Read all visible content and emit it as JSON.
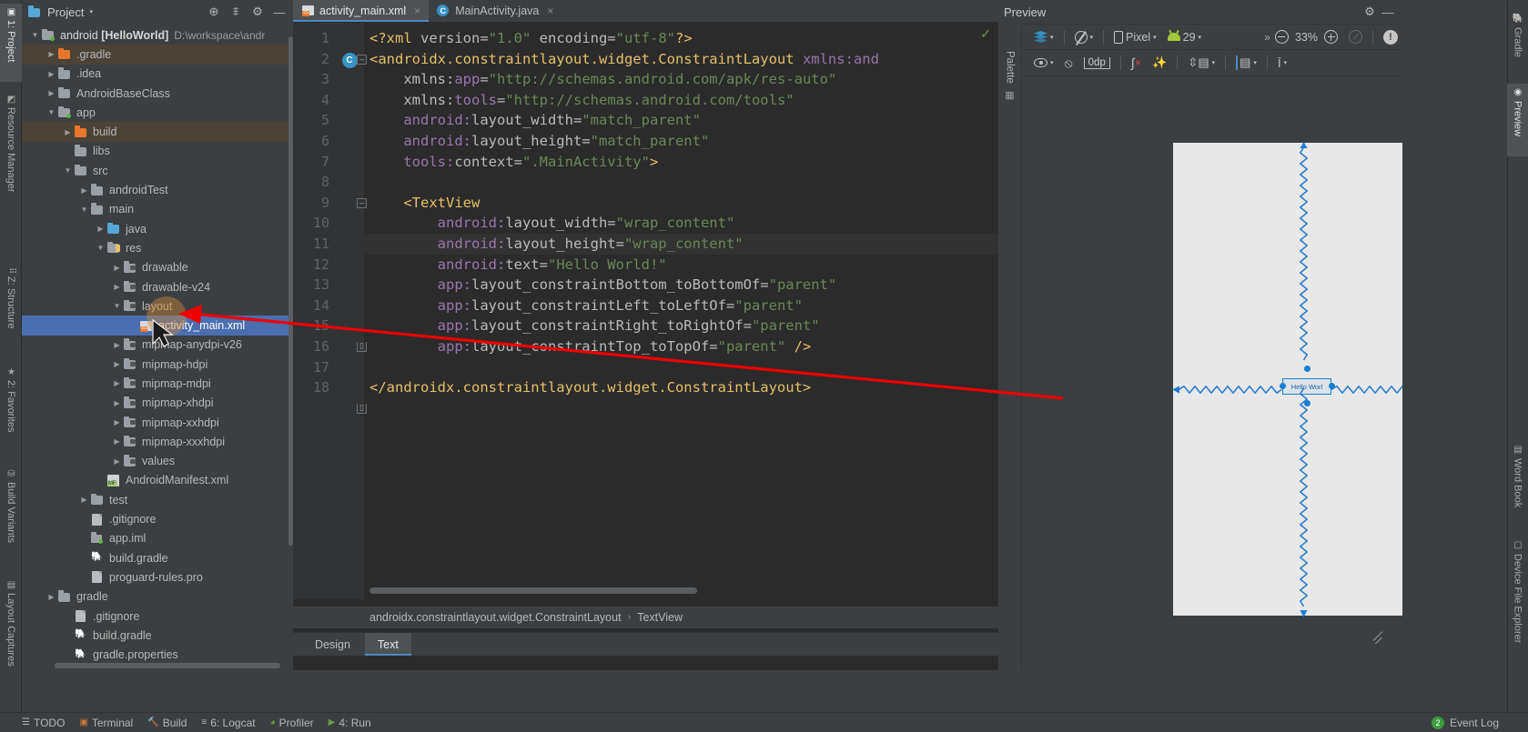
{
  "left_rail": [
    {
      "label": "1: Project",
      "icon": "project-icon",
      "selected": true
    },
    {
      "label": "Resource Manager",
      "icon": "resource-icon",
      "selected": false
    },
    {
      "label": "Z: Structure",
      "icon": "structure-icon",
      "selected": false
    },
    {
      "label": "2: Favorites",
      "icon": "star-icon",
      "selected": false
    },
    {
      "label": "Build Variants",
      "icon": "variants-icon",
      "selected": false
    },
    {
      "label": "Layout Captures",
      "icon": "captures-icon",
      "selected": false
    }
  ],
  "project_panel": {
    "title": "Project",
    "title_caret": "▾",
    "icons": [
      "target-icon",
      "collapse-all-icon",
      "settings-icon",
      "minimize-icon"
    ],
    "tree": [
      {
        "label": "android [HelloWorld]",
        "bold_part": "[HelloWorld]",
        "plain_part": "android",
        "path": "D:\\workspace\\andr",
        "depth": 0,
        "arrow": "▼",
        "icon": "module-folder-icon",
        "state": "root"
      },
      {
        "label": ".gradle",
        "depth": 1,
        "arrow": "▶",
        "icon": "folder-orange-icon",
        "state": "highlight"
      },
      {
        "label": ".idea",
        "depth": 1,
        "arrow": "▶",
        "icon": "folder-grey-icon",
        "state": ""
      },
      {
        "label": "AndroidBaseClass",
        "depth": 1,
        "arrow": "▶",
        "icon": "folder-grey-icon",
        "state": ""
      },
      {
        "label": "app",
        "depth": 1,
        "arrow": "▼",
        "icon": "module-folder-icon",
        "state": ""
      },
      {
        "label": "build",
        "depth": 2,
        "arrow": "▶",
        "icon": "folder-orange-icon",
        "state": "highlight"
      },
      {
        "label": "libs",
        "depth": 2,
        "arrow": "",
        "icon": "folder-grey-icon",
        "state": ""
      },
      {
        "label": "src",
        "depth": 2,
        "arrow": "▼",
        "icon": "folder-grey-icon",
        "state": ""
      },
      {
        "label": "androidTest",
        "depth": 3,
        "arrow": "▶",
        "icon": "folder-grey-icon",
        "state": ""
      },
      {
        "label": "main",
        "depth": 3,
        "arrow": "▼",
        "icon": "folder-grey-icon",
        "state": ""
      },
      {
        "label": "java",
        "depth": 4,
        "arrow": "▶",
        "icon": "folder-java-icon",
        "state": ""
      },
      {
        "label": "res",
        "depth": 4,
        "arrow": "▼",
        "icon": "folder-res-icon",
        "state": ""
      },
      {
        "label": "drawable",
        "depth": 5,
        "arrow": "▶",
        "icon": "folder-drawable-icon",
        "state": ""
      },
      {
        "label": "drawable-v24",
        "depth": 5,
        "arrow": "▶",
        "icon": "folder-drawable-icon",
        "state": ""
      },
      {
        "label": "layout",
        "depth": 5,
        "arrow": "▼",
        "icon": "folder-drawable-icon",
        "state": ""
      },
      {
        "label": "activity_main.xml",
        "depth": 6,
        "arrow": "",
        "icon": "xml-layout-icon",
        "state": "selected"
      },
      {
        "label": "mipmap-anydpi-v26",
        "depth": 5,
        "arrow": "▶",
        "icon": "folder-drawable-icon",
        "state": ""
      },
      {
        "label": "mipmap-hdpi",
        "depth": 5,
        "arrow": "▶",
        "icon": "folder-drawable-icon",
        "state": ""
      },
      {
        "label": "mipmap-mdpi",
        "depth": 5,
        "arrow": "▶",
        "icon": "folder-drawable-icon",
        "state": ""
      },
      {
        "label": "mipmap-xhdpi",
        "depth": 5,
        "arrow": "▶",
        "icon": "folder-drawable-icon",
        "state": ""
      },
      {
        "label": "mipmap-xxhdpi",
        "depth": 5,
        "arrow": "▶",
        "icon": "folder-drawable-icon",
        "state": ""
      },
      {
        "label": "mipmap-xxxhdpi",
        "depth": 5,
        "arrow": "▶",
        "icon": "folder-drawable-icon",
        "state": ""
      },
      {
        "label": "values",
        "depth": 5,
        "arrow": "▶",
        "icon": "folder-drawable-icon",
        "state": ""
      },
      {
        "label": "AndroidManifest.xml",
        "depth": 4,
        "arrow": "",
        "icon": "manifest-icon",
        "state": ""
      },
      {
        "label": "test",
        "depth": 3,
        "arrow": "▶",
        "icon": "folder-grey-icon",
        "state": ""
      },
      {
        "label": ".gitignore",
        "depth": 3,
        "arrow": "",
        "icon": "file-icon",
        "state": ""
      },
      {
        "label": "app.iml",
        "depth": 3,
        "arrow": "",
        "icon": "iml-icon",
        "state": ""
      },
      {
        "label": "build.gradle",
        "depth": 3,
        "arrow": "",
        "icon": "gradle-icon",
        "state": ""
      },
      {
        "label": "proguard-rules.pro",
        "depth": 3,
        "arrow": "",
        "icon": "file-icon",
        "state": ""
      },
      {
        "label": "gradle",
        "depth": 1,
        "arrow": "▶",
        "icon": "folder-grey-icon",
        "state": ""
      },
      {
        "label": ".gitignore",
        "depth": 2,
        "arrow": "",
        "icon": "file-icon",
        "state": ""
      },
      {
        "label": "build.gradle",
        "depth": 2,
        "arrow": "",
        "icon": "gradle-icon",
        "state": ""
      },
      {
        "label": "gradle.properties",
        "depth": 2,
        "arrow": "",
        "icon": "gradle-icon",
        "state": ""
      }
    ]
  },
  "editor": {
    "tabs": [
      {
        "label": "activity_main.xml",
        "icon": "xml-layout-icon",
        "active": true,
        "close": "×"
      },
      {
        "label": "MainActivity.java",
        "icon": "java-class-icon",
        "active": false,
        "close": "×"
      }
    ],
    "inspection_ok": "✓",
    "line_numbers": [
      1,
      2,
      3,
      4,
      5,
      6,
      7,
      8,
      9,
      10,
      11,
      12,
      13,
      14,
      15,
      16,
      17,
      18
    ],
    "current_line": 11,
    "class_marker_line": 2,
    "lines": [
      {
        "n": 1,
        "tokens": [
          {
            "t": "pi",
            "s": "<?xml "
          },
          {
            "t": "attr",
            "s": "version="
          },
          {
            "t": "val",
            "s": "\"1.0\""
          },
          {
            "t": "plain",
            "s": " "
          },
          {
            "t": "attr",
            "s": "encoding="
          },
          {
            "t": "val",
            "s": "\"utf-8\""
          },
          {
            "t": "pi",
            "s": "?>"
          }
        ],
        "indent": 0
      },
      {
        "n": 2,
        "tokens": [
          {
            "t": "tag",
            "s": "<androidx.constraintlayout.widget.ConstraintLayout"
          },
          {
            "t": "plain",
            "s": " "
          },
          {
            "t": "ns",
            "s": "xmlns:and"
          }
        ],
        "indent": 0
      },
      {
        "n": 3,
        "tokens": [
          {
            "t": "plain",
            "s": "    "
          },
          {
            "t": "attr",
            "s": "xmlns:"
          },
          {
            "t": "ns",
            "s": "app"
          },
          {
            "t": "attr",
            "s": "="
          },
          {
            "t": "val",
            "s": "\"http://schemas.android.com/apk/res-auto\""
          }
        ],
        "indent": 1
      },
      {
        "n": 4,
        "tokens": [
          {
            "t": "plain",
            "s": "    "
          },
          {
            "t": "attr",
            "s": "xmlns:"
          },
          {
            "t": "ns",
            "s": "tools"
          },
          {
            "t": "attr",
            "s": "="
          },
          {
            "t": "val",
            "s": "\"http://schemas.android.com/tools\""
          }
        ],
        "indent": 1
      },
      {
        "n": 5,
        "tokens": [
          {
            "t": "plain",
            "s": "    "
          },
          {
            "t": "ns",
            "s": "android:"
          },
          {
            "t": "attr",
            "s": "layout_width="
          },
          {
            "t": "val",
            "s": "\"match_parent\""
          }
        ],
        "indent": 1
      },
      {
        "n": 6,
        "tokens": [
          {
            "t": "plain",
            "s": "    "
          },
          {
            "t": "ns",
            "s": "android:"
          },
          {
            "t": "attr",
            "s": "layout_height="
          },
          {
            "t": "val",
            "s": "\"match_parent\""
          }
        ],
        "indent": 1
      },
      {
        "n": 7,
        "tokens": [
          {
            "t": "plain",
            "s": "    "
          },
          {
            "t": "ns",
            "s": "tools:"
          },
          {
            "t": "attr",
            "s": "context="
          },
          {
            "t": "val",
            "s": "\".MainActivity\""
          },
          {
            "t": "tag",
            "s": ">"
          }
        ],
        "indent": 1
      },
      {
        "n": 8,
        "tokens": [],
        "indent": 0
      },
      {
        "n": 9,
        "tokens": [
          {
            "t": "plain",
            "s": "    "
          },
          {
            "t": "tag",
            "s": "<TextView"
          }
        ],
        "indent": 1
      },
      {
        "n": 10,
        "tokens": [
          {
            "t": "plain",
            "s": "        "
          },
          {
            "t": "ns",
            "s": "android:"
          },
          {
            "t": "attr",
            "s": "layout_width="
          },
          {
            "t": "val",
            "s": "\"wrap_content\""
          }
        ],
        "indent": 2
      },
      {
        "n": 11,
        "tokens": [
          {
            "t": "plain",
            "s": "        "
          },
          {
            "t": "ns",
            "s": "android:"
          },
          {
            "t": "attr",
            "s": "layout_height="
          },
          {
            "t": "val",
            "s": "\"wrap_content\""
          }
        ],
        "indent": 2
      },
      {
        "n": 12,
        "tokens": [
          {
            "t": "plain",
            "s": "        "
          },
          {
            "t": "ns",
            "s": "android:"
          },
          {
            "t": "attr",
            "s": "text="
          },
          {
            "t": "val",
            "s": "\"Hello World!\""
          }
        ],
        "indent": 2
      },
      {
        "n": 13,
        "tokens": [
          {
            "t": "plain",
            "s": "        "
          },
          {
            "t": "ns",
            "s": "app:"
          },
          {
            "t": "attr",
            "s": "layout_constraintBottom_toBottomOf="
          },
          {
            "t": "val",
            "s": "\"parent\""
          }
        ],
        "indent": 2
      },
      {
        "n": 14,
        "tokens": [
          {
            "t": "plain",
            "s": "        "
          },
          {
            "t": "ns",
            "s": "app:"
          },
          {
            "t": "attr",
            "s": "layout_constraintLeft_toLeftOf="
          },
          {
            "t": "val",
            "s": "\"parent\""
          }
        ],
        "indent": 2
      },
      {
        "n": 15,
        "tokens": [
          {
            "t": "plain",
            "s": "        "
          },
          {
            "t": "ns",
            "s": "app:"
          },
          {
            "t": "attr",
            "s": "layout_constraintRight_toRightOf="
          },
          {
            "t": "val",
            "s": "\"parent\""
          }
        ],
        "indent": 2
      },
      {
        "n": 16,
        "tokens": [
          {
            "t": "plain",
            "s": "        "
          },
          {
            "t": "ns",
            "s": "app:"
          },
          {
            "t": "attr",
            "s": "layout_constraintTop_toTopOf="
          },
          {
            "t": "val",
            "s": "\"parent\""
          },
          {
            "t": "plain",
            "s": " "
          },
          {
            "t": "tag",
            "s": "/>"
          }
        ],
        "indent": 2
      },
      {
        "n": 17,
        "tokens": [],
        "indent": 0
      },
      {
        "n": 18,
        "tokens": [
          {
            "t": "tag",
            "s": "</androidx.constraintlayout.widget.ConstraintLayout>"
          }
        ],
        "indent": 0
      }
    ],
    "breadcrumb": [
      "androidx.constraintlayout.widget.ConstraintLayout",
      "TextView"
    ],
    "breadcrumb_sep": "›",
    "bottom_tabs": [
      {
        "label": "Design",
        "active": false
      },
      {
        "label": "Text",
        "active": true
      }
    ]
  },
  "preview": {
    "title": "Preview",
    "header_icons": [
      "settings-icon",
      "minimize-icon"
    ],
    "palette_label": "Palette",
    "toolbar_row1": {
      "design_mode": {
        "label": "",
        "icon": "layers-icon",
        "caret": "▾"
      },
      "orientation": {
        "label": "",
        "icon": "orientation-icon",
        "caret": "▾"
      },
      "device": {
        "label": "Pixel",
        "icon": "phone-icon",
        "caret": "▾"
      },
      "api_level": {
        "label": "29",
        "icon": "android-icon",
        "caret": "▾"
      },
      "overflow": "»",
      "zoom_out": "zoom-out-icon",
      "zoom_level": "33%",
      "zoom_in": "zoom-in-icon",
      "zoom_fit": "zoom-fit-icon",
      "issues": "!"
    },
    "toolbar_row2": {
      "visibility": {
        "icon": "eye-icon",
        "caret": "▾"
      },
      "constraints_off": {
        "icon": "no-constraints-icon"
      },
      "margin": {
        "label": "0dp"
      },
      "clear_constraints": {
        "icon": "clear-constraints-icon"
      },
      "infer_constraints": {
        "icon": "magic-wand-icon"
      },
      "guidelines": {
        "icon": "guidelines-icon",
        "caret": "▾"
      },
      "align": {
        "icon": "align-icon",
        "caret": "▾"
      },
      "baseline": {
        "icon": "baseline-icon",
        "caret": "▾"
      }
    },
    "widget": {
      "text": "Hello Worl",
      "name": "TextView"
    }
  },
  "right_rail": [
    {
      "label": "Gradle",
      "icon": "gradle-icon",
      "selected": false
    },
    {
      "label": "Preview",
      "icon": "eye-icon",
      "selected": true
    },
    {
      "label": "Word Book",
      "icon": "book-icon",
      "selected": false
    },
    {
      "label": "Device File Explorer",
      "icon": "device-icon",
      "selected": false
    }
  ],
  "status_bar": {
    "items": [
      {
        "label": "TODO",
        "icon": "todo-icon"
      },
      {
        "label": "Terminal",
        "icon": "terminal-icon"
      },
      {
        "label": "Build",
        "icon": "build-icon"
      },
      {
        "label": "6: Logcat",
        "icon": "logcat-icon"
      },
      {
        "label": "Profiler",
        "icon": "profiler-icon"
      },
      {
        "label": "4: Run",
        "icon": "run-icon"
      }
    ],
    "event_log": {
      "label": "Event Log",
      "badge": "2"
    }
  },
  "colors": {
    "accent_blue": "#4b6eaf",
    "annotation_red": "#ee0000",
    "selection_blue": "#1a7fd4",
    "tag_orange": "#e8bf6a",
    "string_green": "#6a8759",
    "namespace_purple": "#9876aa"
  }
}
